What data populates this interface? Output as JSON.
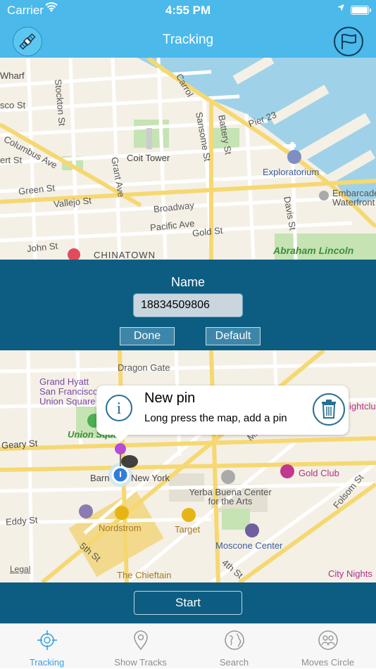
{
  "status_bar": {
    "carrier": "Carrier",
    "time": "4:55 PM"
  },
  "nav": {
    "title": "Tracking",
    "left_icon": "satellite-icon",
    "right_icon": "flag-icon"
  },
  "map_top_labels": {
    "wharf": "Wharf",
    "stockton": "Stockton St",
    "sco": "sco St",
    "columbus": "Columbus Ave",
    "coit": "Coit Tower",
    "grant": "Grant Ave",
    "green": "Green St",
    "vallejo": "Vallejo St",
    "broadway": "Broadway",
    "pacific": "Pacific Ave",
    "gold": "Gold St",
    "john": "John St",
    "chinatown": "CHINATOWN",
    "sansome": "Sansome St",
    "battery": "Battery St",
    "pier23": "Pier 23",
    "exploratorium": "Exploratorium",
    "embarcadero": "Embarcadero Waterfront",
    "davis": "Davis St",
    "abraham": "Abraham Lincoln",
    "ert": "ert St",
    "rt": "rt St",
    "dd": "d St",
    "carroll": "Carrol"
  },
  "name_panel": {
    "title": "Name",
    "value": "18834509806",
    "done_label": "Done",
    "default_label": "Default"
  },
  "map_bottom_labels": {
    "dragon": "Dragon Gate",
    "grand": "Grand Hyatt San Francisco Union Square",
    "union": "Union Square",
    "geary": "Geary St",
    "barnes": "Barn",
    "newyork": "New York",
    "nordstrom": "Nordstrom",
    "target": "Target",
    "yerba": "Yerba Buena Center for the Arts",
    "moscone": "Moscone Center",
    "goldclub": "Gold Club",
    "folsom": "Folsom St",
    "eddy": "Eddy St",
    "fifth": "5th St",
    "fourth": "4th St",
    "mission": "Missi",
    "legal": "Legal",
    "chieftain": "The Chieftain",
    "citynights": "City Nights",
    "nightclub": "ightclu"
  },
  "callout": {
    "title": "New pin",
    "subtitle": "Long press the map, add a pin"
  },
  "start_label": "Start",
  "tabs": [
    {
      "label": "Tracking",
      "icon": "crosshair-icon",
      "active": true
    },
    {
      "label": "Show Tracks",
      "icon": "map-pin-icon",
      "active": false
    },
    {
      "label": "Search",
      "icon": "globe-icon",
      "active": false
    },
    {
      "label": "Moves Circle",
      "icon": "people-icon",
      "active": false
    }
  ],
  "colors": {
    "nav_bg": "#4bb9ea",
    "panel_bg": "#0d5d82",
    "water": "#9fd2e8",
    "park": "#c6e3b4",
    "road_major": "#f6d872"
  }
}
